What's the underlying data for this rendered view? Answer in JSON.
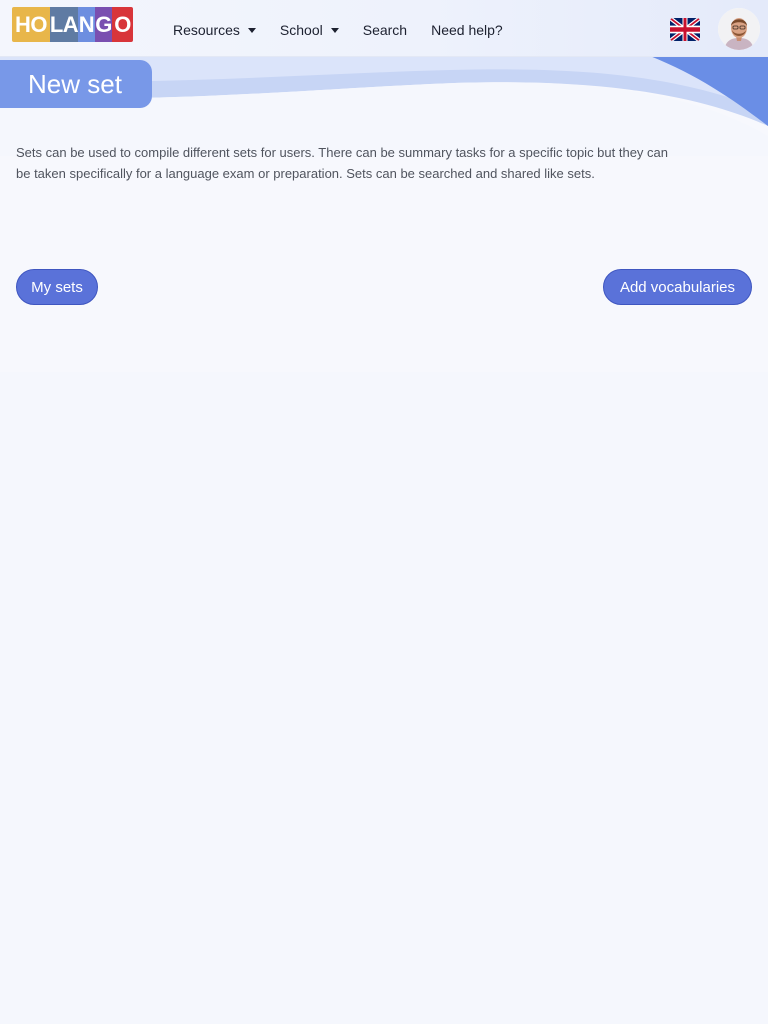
{
  "brand": {
    "logo_letters": [
      {
        "text": "HO",
        "color": "#e8b64a"
      },
      {
        "text": "LA",
        "color": "#5f7ba3"
      },
      {
        "text": "N",
        "color": "#6d8ee0"
      },
      {
        "text": "G",
        "color": "#7a4fb0"
      },
      {
        "text": "O",
        "color": "#d8353a"
      }
    ]
  },
  "nav": {
    "items": [
      {
        "label": "Resources",
        "dropdown": true
      },
      {
        "label": "School",
        "dropdown": true
      },
      {
        "label": "Search",
        "dropdown": false
      },
      {
        "label": "Need help?",
        "dropdown": false
      }
    ],
    "language_icon": "uk-flag-icon",
    "avatar_icon": "user-avatar"
  },
  "page": {
    "title": "New set",
    "description": "Sets can be used to compile different sets for users. There can be summary tasks for a specific topic but they can be taken specifically for a language exam or preparation. Sets can be searched and shared like sets."
  },
  "actions": {
    "my_sets_label": "My sets",
    "add_vocabularies_label": "Add vocabularies"
  },
  "colors": {
    "accent": "#5a72d9",
    "title_pill": "#7898e8",
    "background": "#f5f7fd"
  }
}
